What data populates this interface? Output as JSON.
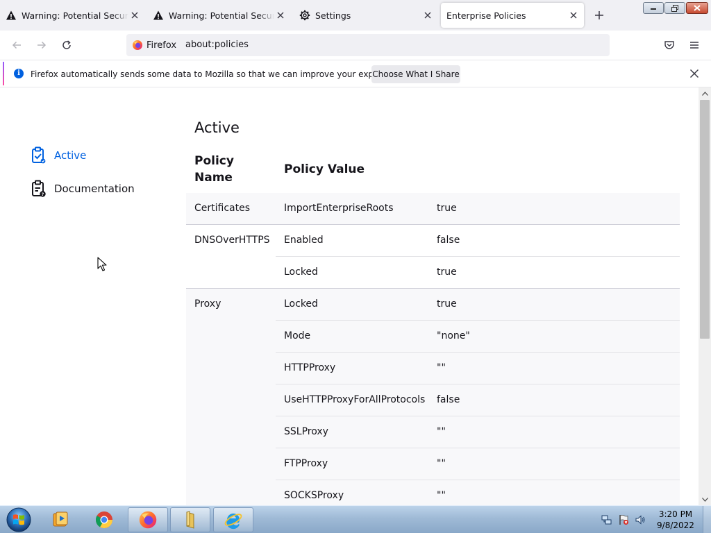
{
  "browser": {
    "tabs": [
      {
        "label": "Warning: Potential Security Risk Ahead",
        "icon": "warning-icon"
      },
      {
        "label": "Warning: Potential Security Risk Ahead",
        "icon": "warning-icon"
      },
      {
        "label": "Settings",
        "icon": "gear-icon"
      },
      {
        "label": "Enterprise Policies",
        "icon": "none",
        "active": true
      }
    ],
    "identity_label": "Firefox",
    "url": "about:policies"
  },
  "notification": {
    "message": "Firefox automatically sends some data to Mozilla so that we can improve your experience.",
    "button_label": "Choose What I Share"
  },
  "sidebar": {
    "items": [
      {
        "label": "Active",
        "icon": "policy-active-icon",
        "selected": true
      },
      {
        "label": "Documentation",
        "icon": "policy-docs-icon",
        "selected": false
      }
    ]
  },
  "main": {
    "heading": "Active",
    "columns": {
      "name": "Policy Name",
      "value": "Policy Value"
    },
    "rows": [
      {
        "policy": "Certificates",
        "key": "ImportEnterpriseRoots",
        "value": "true"
      },
      {
        "policy": "DNSOverHTTPS",
        "key": "Enabled",
        "value": "false"
      },
      {
        "policy": "",
        "key": "Locked",
        "value": "true"
      },
      {
        "policy": "Proxy",
        "key": "Locked",
        "value": "true"
      },
      {
        "policy": "",
        "key": "Mode",
        "value": "\"none\""
      },
      {
        "policy": "",
        "key": "HTTPProxy",
        "value": "\"\""
      },
      {
        "policy": "",
        "key": "UseHTTPProxyForAllProtocols",
        "value": "false"
      },
      {
        "policy": "",
        "key": "SSLProxy",
        "value": "\"\""
      },
      {
        "policy": "",
        "key": "FTPProxy",
        "value": "\"\""
      },
      {
        "policy": "",
        "key": "SOCKSProxy",
        "value": "\"\""
      }
    ]
  },
  "taskbar": {
    "time": "3:20 PM",
    "date": "9/8/2022"
  },
  "colors": {
    "accent": "#0061e0",
    "tabstrip": "#f0f0f4",
    "row_shade": "#f8f8fa"
  }
}
